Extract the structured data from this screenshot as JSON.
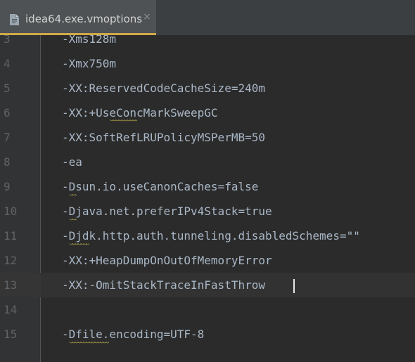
{
  "tab": {
    "icon": "file-icon",
    "label": "idea64.exe.vmoptions",
    "close_glyph": "×"
  },
  "editor": {
    "lines": [
      {
        "number": "3",
        "text": "-Xms128m"
      },
      {
        "number": "4",
        "text": "-Xmx750m"
      },
      {
        "number": "5",
        "text": "-XX:ReservedCodeCacheSize=240m"
      },
      {
        "number": "6",
        "text": "-XX:+UseConcMarkSweepGC"
      },
      {
        "number": "7",
        "text": "-XX:SoftRefLRUPolicyMSPerMB=50"
      },
      {
        "number": "8",
        "text": "-ea"
      },
      {
        "number": "9",
        "text": "-Dsun.io.useCanonCaches=false"
      },
      {
        "number": "10",
        "text": "-Djava.net.preferIPv4Stack=true"
      },
      {
        "number": "11",
        "text": "-Djdk.http.auth.tunneling.disabledSchemes=\"\""
      },
      {
        "number": "12",
        "text": "-XX:+HeapDumpOnOutOfMemoryError"
      },
      {
        "number": "13",
        "text": "-XX:-OmitStackTraceInFastThrow"
      },
      {
        "number": "14",
        "text": ""
      },
      {
        "number": "15",
        "text": "-Dfile.encoding=UTF-8"
      }
    ],
    "caret_line": "13"
  },
  "colors": {
    "background": "#2b2b2b",
    "gutter": "#313335",
    "tab_active": "#4e5254",
    "tab_underline": "#d1a949",
    "text": "#a9b7c6",
    "line_number": "#606366",
    "typo_squiggle": "#b5a64a"
  }
}
